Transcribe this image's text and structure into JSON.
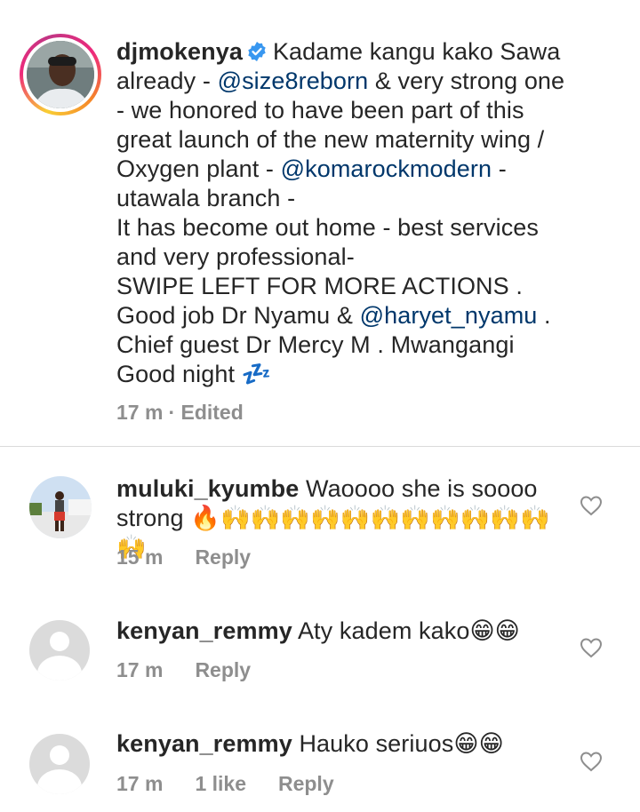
{
  "caption": {
    "username": "djmokenya",
    "lines": [
      {
        "parts": [
          {
            "t": "Kadame kangu kako Sawa",
            "m": false
          }
        ]
      },
      {
        "parts": [
          {
            "t": "already - ",
            "m": false
          },
          {
            "t": "@size8reborn",
            "m": true
          },
          {
            "t": " & very strong one",
            "m": false
          }
        ]
      },
      {
        "parts": [
          {
            "t": "- we honored to have been part of this",
            "m": false
          }
        ]
      },
      {
        "parts": [
          {
            "t": "great launch of the new maternity wing /",
            "m": false
          }
        ]
      },
      {
        "parts": [
          {
            "t": "Oxygen plant - ",
            "m": false
          },
          {
            "t": "@komarockmodern",
            "m": true
          },
          {
            "t": " -",
            "m": false
          }
        ]
      },
      {
        "parts": [
          {
            "t": "utawala branch -",
            "m": false
          }
        ]
      },
      {
        "parts": [
          {
            "t": "It has become out home - best services",
            "m": false
          }
        ]
      },
      {
        "parts": [
          {
            "t": "and very professional-",
            "m": false
          }
        ]
      },
      {
        "parts": [
          {
            "t": "SWIPE LEFT FOR MORE ACTIONS .",
            "m": false
          }
        ]
      },
      {
        "parts": [
          {
            "t": "Good job Dr Nyamu & ",
            "m": false
          },
          {
            "t": "@haryet_nyamu",
            "m": true
          },
          {
            "t": " .",
            "m": false
          }
        ]
      },
      {
        "parts": [
          {
            "t": "Chief guest Dr Mercy M . Mwangangi",
            "m": false
          }
        ]
      },
      {
        "parts": [
          {
            "t": "Good night 💤",
            "m": false
          }
        ]
      }
    ],
    "time": "17 m",
    "edited": "· Edited"
  },
  "comments": [
    {
      "username": "muluki_kyumbe",
      "line1": "Waoooo she is soooo",
      "line2": "strong 🔥🙌🙌🙌🙌🙌🙌🙌🙌🙌🙌🙌🙌",
      "time": "15 m",
      "likes": "",
      "reply": "Reply"
    },
    {
      "username": "kenyan_remmy",
      "line1": "Aty kadem kako😁😁",
      "time": "17 m",
      "likes": "",
      "reply": "Reply"
    },
    {
      "username": "kenyan_remmy",
      "line1": "Hauko seriuos😁😁",
      "time": "17 m",
      "likes": "1 like",
      "reply": "Reply"
    }
  ],
  "colors": {
    "text": "#262626",
    "mention": "#00376b",
    "meta": "#8e8e8e",
    "verified": "#3897f0",
    "divider": "#dbdbdb"
  }
}
